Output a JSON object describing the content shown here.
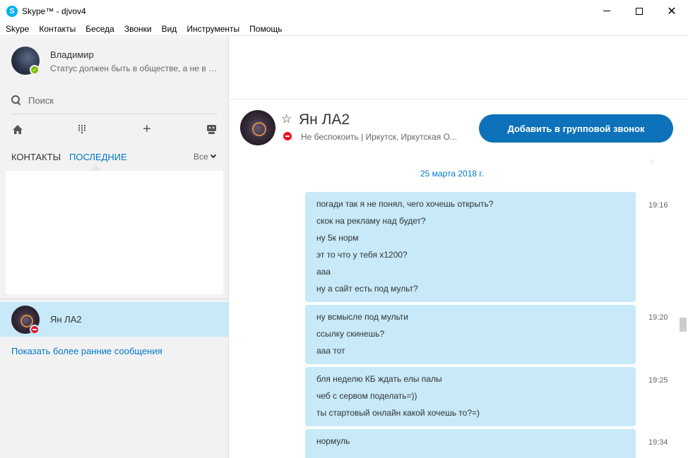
{
  "window": {
    "title": "Skype™ - djvov4",
    "app_icon": "S"
  },
  "menu": {
    "items": [
      "Skype",
      "Контакты",
      "Беседа",
      "Звонки",
      "Вид",
      "Инструменты",
      "Помощь"
    ]
  },
  "profile": {
    "name": "Владимир",
    "mood": "Статус должен быть в обществе, а не в с...",
    "status": "online",
    "status_color": "#7fba00"
  },
  "search": {
    "placeholder": "Поиск"
  },
  "toolbar": {
    "icons": [
      "home-icon",
      "dialpad-icon",
      "add-icon",
      "bot-icon"
    ],
    "add_glyph": "+"
  },
  "tabs": {
    "contacts": "КОНТАКТЫ",
    "recent": "ПОСЛЕДНИЕ",
    "filter": "Все"
  },
  "conversations": [
    {
      "name": "Ян ЛА2",
      "status": "dnd"
    }
  ],
  "older_messages_link": "Показать более ранние сообщения",
  "contact": {
    "name": "Ян ЛА2",
    "status_text": "Не беспокоить | Иркутск, Иркутская О...",
    "status_color": "#e81123",
    "group_call_button": "Добавить в групповой звонок",
    "accent_color": "#0d72b9"
  },
  "chat": {
    "date_separator": "25 марта 2018 г.",
    "messages": [
      {
        "time": "19:16",
        "lines": [
          "погади так я не понял, чего хочешь открыть?",
          "скок на рекламу над будет?",
          "ну 5к норм",
          "эт то что у тебя х1200?",
          "ааа",
          "ну а сайт есть под мульт?"
        ]
      },
      {
        "time": "19:20",
        "lines": [
          "ну всмысле под мульти",
          "ссылку скинешь?",
          "ааа тот"
        ]
      },
      {
        "time": "19:25",
        "lines": [
          "бля неделю КБ ждать елы палы",
          "чеб с сервом поделать=))",
          "ты стартовый онлайн какой хочешь то?=)"
        ]
      },
      {
        "time": "19:34",
        "lines": [
          "нормуль"
        ]
      }
    ]
  }
}
